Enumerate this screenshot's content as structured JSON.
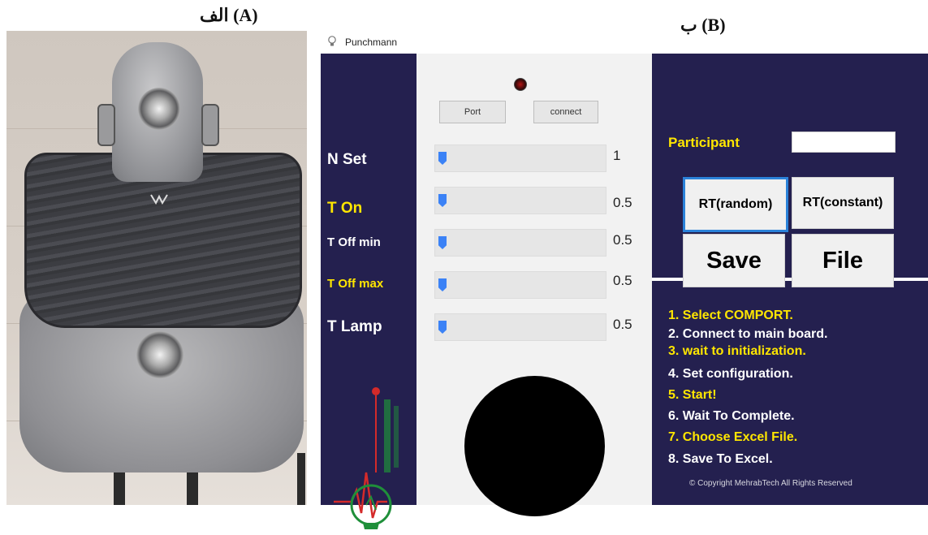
{
  "labels": {
    "panel_a": "الف (A)",
    "panel_b": "ب (B)"
  },
  "window": {
    "title": "Punchmann",
    "icon": "lightbulb-icon"
  },
  "connection": {
    "port_label": "Port",
    "connect_label": "connect",
    "status_led_color": "#b31616"
  },
  "parameters": [
    {
      "label": "N Set",
      "value": "1",
      "color": "#ffffff",
      "level": 0.0
    },
    {
      "label": "T On",
      "value": "0.5",
      "color": "#ffe600",
      "level": 0.0
    },
    {
      "label": "T Off  min",
      "value": "0.5",
      "color": "#ffffff",
      "level": 0.0
    },
    {
      "label": "T Off  max",
      "value": "0.5",
      "color": "#ffe600",
      "level": 0.0
    },
    {
      "label": "T Lamp",
      "value": "0.5",
      "color": "#ffffff",
      "level": 0.0
    }
  ],
  "participant": {
    "label": "Participant",
    "value": ""
  },
  "buttons": {
    "rt_random": "RT(random)",
    "rt_constant": "RT(constant)",
    "save": "Save",
    "file": "File"
  },
  "instructions": [
    {
      "text": "1. Select COMPORT.",
      "color": "#ffe600"
    },
    {
      "text": "2. Connect to main board.",
      "color": "#ffffff"
    },
    {
      "text": "3. wait to initialization.",
      "color": "#ffe600"
    },
    {
      "text": "4. Set configuration.",
      "color": "#ffffff"
    },
    {
      "text": "5. Start!",
      "color": "#ffe600"
    },
    {
      "text": "6. Wait To  Complete.",
      "color": "#ffffff"
    },
    {
      "text": "7. Choose Excel File.",
      "color": "#ffe600"
    },
    {
      "text": "8. Save To Excel.",
      "color": "#ffffff"
    }
  ],
  "copyright": "© Copyright MehrabTech All Rights Reserved",
  "colors": {
    "panel_navy": "#24204f",
    "accent_yellow": "#ffe600",
    "logo_green": "#1f8f3a",
    "logo_red": "#d42a2a"
  }
}
